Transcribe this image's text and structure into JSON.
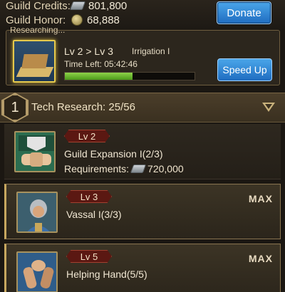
{
  "resources": {
    "credits_label": "Guild Credits:",
    "credits_value": "801,800",
    "honor_label": "Guild Honor:",
    "honor_value": "68,888",
    "donate_label": "Donate"
  },
  "researching": {
    "header": "Researching...",
    "level_change": "Lv 2 > Lv 3",
    "name": "Irrigation I",
    "time_left": "Time Left: 05:42:46",
    "progress": 0.52,
    "speed_up_label": "Speed Up"
  },
  "section": {
    "tier": "1",
    "title": "Tech Research: 25/56"
  },
  "items": [
    {
      "level": "Lv 2",
      "name": "Guild Expansion I(2/3)",
      "req_label": "Requirements:",
      "req_value": "720,000",
      "max": ""
    },
    {
      "level": "Lv 3",
      "name": "Vassal I(3/3)",
      "max": "MAX"
    },
    {
      "level": "Lv 5",
      "name": "Helping Hand(5/5)",
      "max": "MAX"
    }
  ],
  "colors": {
    "accent_blue": "#1f6cc0",
    "progress_green": "#6cb82e",
    "gold_border": "#c7a75f"
  }
}
